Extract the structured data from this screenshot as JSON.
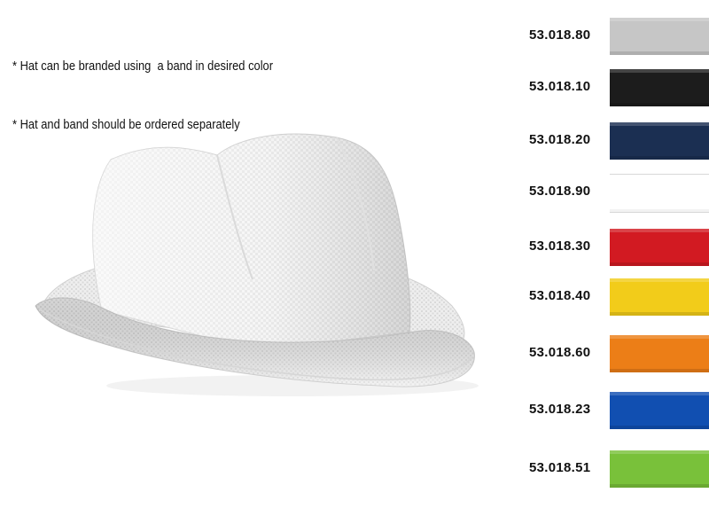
{
  "notes": [
    "* Hat can be branded using  a band in desired color",
    "* Hat and band should be ordered separately"
  ],
  "image": {
    "name": "white straw hat"
  },
  "bands": [
    {
      "code": "53.018.80",
      "color": "#c6c6c6"
    },
    {
      "code": "53.018.10",
      "color": "#1c1c1c"
    },
    {
      "code": "53.018.20",
      "color": "#1b2f52"
    },
    {
      "code": "53.018.90",
      "color": "#ffffff"
    },
    {
      "code": "53.018.30",
      "color": "#d21a22"
    },
    {
      "code": "53.018.40",
      "color": "#f2cc1a"
    },
    {
      "code": "53.018.60",
      "color": "#ec7e17"
    },
    {
      "code": "53.018.23",
      "color": "#114fb1"
    },
    {
      "code": "53.018.51",
      "color": "#79c13a"
    }
  ]
}
